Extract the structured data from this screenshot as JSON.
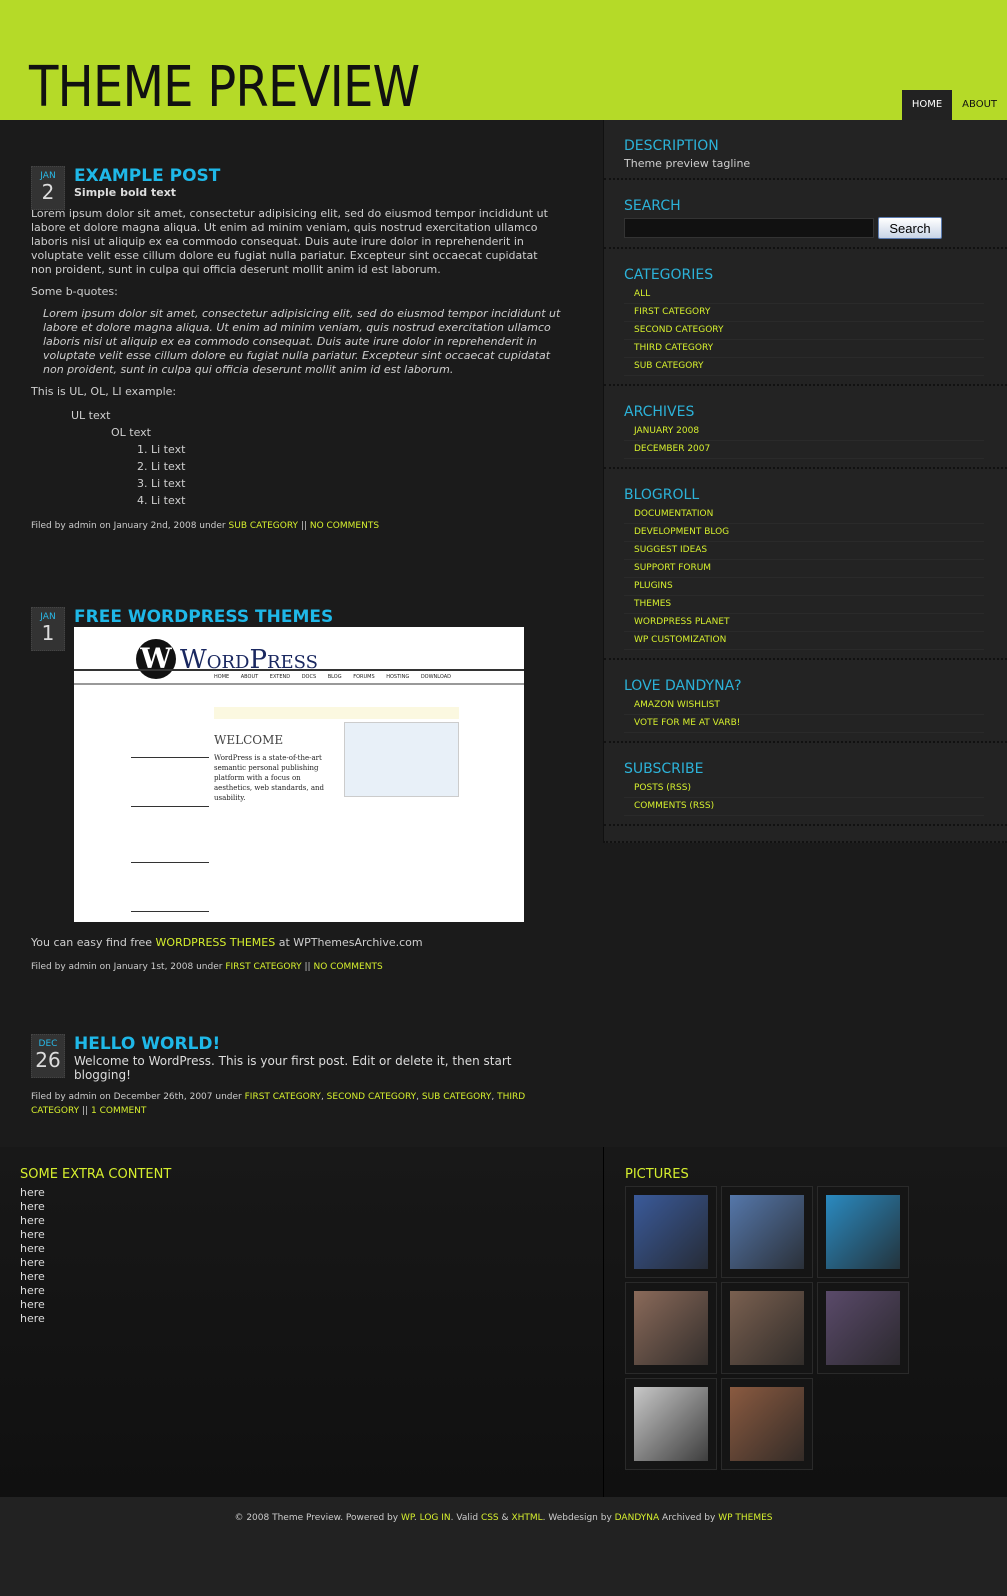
{
  "header": {
    "title": "THEME PREVIEW",
    "nav": [
      "HOME",
      "ABOUT"
    ]
  },
  "posts": [
    {
      "month": "JAN",
      "day": "2",
      "title": "EXAMPLE POST",
      "subtitle": "Simple bold text",
      "para": "Lorem ipsum dolor sit amet, consectetur adipisicing elit, sed do eiusmod tempor incididunt ut labore et dolore magna aliqua. Ut enim ad minim veniam, quis nostrud exercitation ullamco laboris nisi ut aliquip ex ea commodo consequat. Duis aute irure dolor in reprehenderit in voluptate velit esse cillum dolore eu fugiat nulla pariatur. Excepteur sint occaecat cupidatat non proident, sunt in culpa qui officia deserunt mollit anim id est laborum.",
      "bq_label": "Some b-quotes:",
      "quote": "Lorem ipsum dolor sit amet, consectetur adipisicing elit, sed do eiusmod tempor incididunt ut labore et dolore magna aliqua. Ut enim ad minim veniam, quis nostrud exercitation ullamco laboris nisi ut aliquip ex ea commodo consequat. Duis aute irure dolor in reprehenderit in voluptate velit esse cillum dolore eu fugiat nulla pariatur. Excepteur sint occaecat cupidatat non proident, sunt in culpa qui officia deserunt mollit anim id est laborum.",
      "list_label": "This is UL, OL, LI example:",
      "ul": "UL text",
      "ol": "OL text",
      "li": [
        "Li text",
        "Li text",
        "Li text",
        "Li text"
      ],
      "meta": "Filed by admin on January 2nd, 2008 under",
      "cats": [
        "SUB CATEGORY"
      ],
      "sep": "||",
      "comments": "NO COMMENTS"
    },
    {
      "month": "JAN",
      "day": "1",
      "title": "FREE WORDPRESS THEMES",
      "image": {
        "logo": "WordPress",
        "nav": [
          "HOME",
          "ABOUT",
          "EXTEND",
          "DOCS",
          "BLOG",
          "FORUMS",
          "HOSTING",
          "DOWNLOAD"
        ],
        "heading": "WELCOME",
        "text": "WordPress is a state-of-the-art semantic personal publishing platform with a focus on aesthetics, web standards, and usability."
      },
      "text_pre": "You can easy find free",
      "text_link": "WORDPRESS THEMES",
      "text_post": "at WPThemesArchive.com",
      "meta": "Filed by admin on January 1st, 2008 under",
      "cats": [
        "FIRST CATEGORY"
      ],
      "sep": "||",
      "comments": "NO COMMENTS"
    },
    {
      "month": "DEC",
      "day": "26",
      "title": "HELLO WORLD!",
      "text": "Welcome to WordPress. This is your first post. Edit or delete it, then start blogging!",
      "meta": "Filed by admin on December 26th, 2007 under",
      "cats": [
        "FIRST CATEGORY",
        "SECOND CATEGORY",
        "SUB CATEGORY",
        "THIRD CATEGORY"
      ],
      "sep": "||",
      "comments": "1 COMMENT"
    }
  ],
  "sidebar": {
    "description": {
      "title": "DESCRIPTION",
      "text": "Theme preview tagline"
    },
    "search": {
      "title": "SEARCH",
      "value": "",
      "button": "Search"
    },
    "widgets": [
      {
        "title": "CATEGORIES",
        "items": [
          "ALL",
          "FIRST CATEGORY",
          "SECOND CATEGORY",
          "THIRD CATEGORY",
          "SUB CATEGORY"
        ]
      },
      {
        "title": "ARCHIVES",
        "items": [
          "JANUARY 2008",
          "DECEMBER 2007"
        ]
      },
      {
        "title": "BLOGROLL",
        "items": [
          "DOCUMENTATION",
          "DEVELOPMENT BLOG",
          "SUGGEST IDEAS",
          "SUPPORT FORUM",
          "PLUGINS",
          "THEMES",
          "WORDPRESS PLANET",
          "WP CUSTOMIZATION"
        ]
      },
      {
        "title": "LOVE DANDYNA?",
        "items": [
          "AMAZON WISHLIST",
          "VOTE FOR ME AT VARB!"
        ]
      },
      {
        "title": "SUBSCRIBE",
        "items": [
          "POSTS (RSS)",
          "COMMENTS (RSS)"
        ]
      }
    ]
  },
  "extra": {
    "title": "SOME EXTRA CONTENT",
    "lines": [
      "here",
      "here",
      "here",
      "here",
      "here",
      "here",
      "here",
      "here",
      "here",
      "here"
    ]
  },
  "pictures": {
    "title": "PICTURES",
    "colors": [
      "#3a5a9a",
      "#5577aa",
      "#2a8ac0",
      "#8a6a5a",
      "#7a6050",
      "#5a4a6a",
      "#c8c8c8",
      "#8a5a40"
    ]
  },
  "footer": {
    "t1": "© 2008 Theme Preview. Powered by",
    "wp": "WP",
    "login": "LOG IN",
    "t2": "Valid",
    "css": "CSS",
    "amp": "&",
    "xhtml": "XHTML",
    "t3": "Webdesign by",
    "dandyna": "DANDYNA",
    "t4": "Archived by",
    "wpthemes": "WP THEMES"
  },
  "colors": {
    "accent": "#b5da28",
    "title": "#1fb8e8",
    "link": "#d6ef2e"
  }
}
